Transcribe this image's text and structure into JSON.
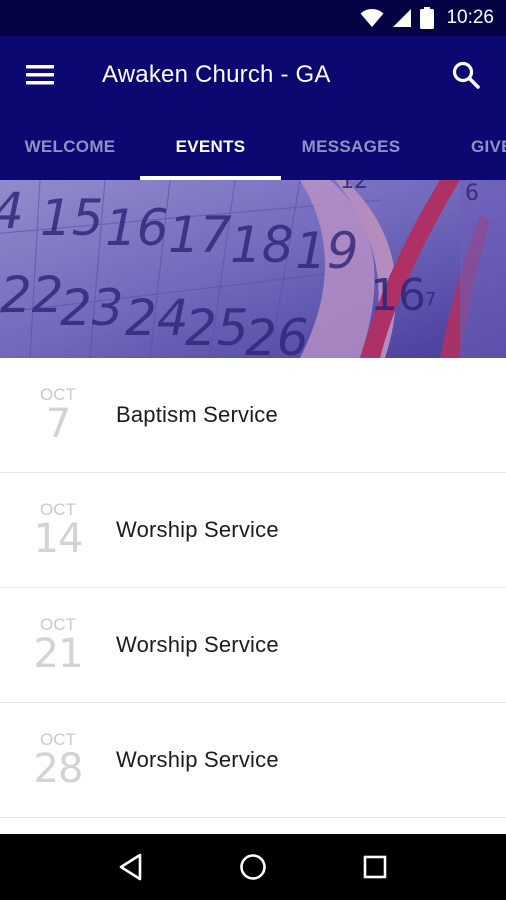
{
  "status_bar": {
    "time": "10:26",
    "icons": [
      "wifi-icon",
      "cell-signal-icon",
      "battery-icon"
    ]
  },
  "app_bar": {
    "title": "Awaken Church - GA",
    "menu_icon": "hamburger-menu-icon",
    "search_icon": "search-icon"
  },
  "tabs": [
    {
      "label": "WELCOME",
      "active": false
    },
    {
      "label": "EVENTS",
      "active": true
    },
    {
      "label": "MESSAGES",
      "active": false
    },
    {
      "label": "GIVE",
      "active": false
    }
  ],
  "banner": {
    "image": "calendar-banner-image",
    "row1": [
      "4",
      "15",
      "16",
      "17",
      "18",
      "19"
    ],
    "row2": [
      "22",
      "23",
      "24",
      "25",
      "26"
    ],
    "extra": [
      "16",
      "6",
      "7",
      "12"
    ]
  },
  "events": [
    {
      "month": "OCT",
      "day": "7",
      "title": "Baptism Service"
    },
    {
      "month": "OCT",
      "day": "14",
      "title": "Worship Service"
    },
    {
      "month": "OCT",
      "day": "21",
      "title": "Worship Service"
    },
    {
      "month": "OCT",
      "day": "28",
      "title": "Worship Service"
    }
  ],
  "nav_bar": {
    "icons": [
      "back-icon",
      "home-icon",
      "recents-icon"
    ]
  },
  "colors": {
    "status_bar": "#060344",
    "app_bar": "#0b0872",
    "banner_tint": "#6b62b6",
    "accent_red": "#c8325a"
  }
}
